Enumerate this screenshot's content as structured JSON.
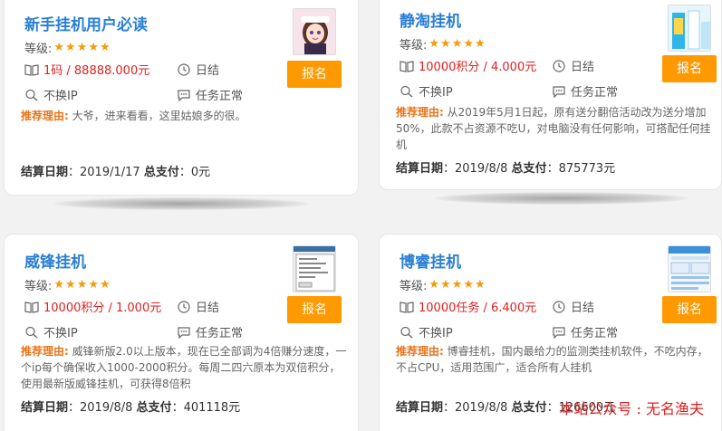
{
  "cards": [
    {
      "title": "新手挂机用户必读",
      "level_label": "等级:",
      "stars": "★★★★★",
      "price": "1码 / 88888.000元",
      "cycle": "日结",
      "ip": "不换IP",
      "status": "任务正常",
      "button": "报名",
      "reason_label": "推荐理由:",
      "reason": "大爷，进来看看，这里姑娘多的很。",
      "settle_label": "结算日期",
      "settle_date": "：2019/1/17",
      "pay_label": "总支付",
      "pay_value": "：0元"
    },
    {
      "title": "静淘挂机",
      "level_label": "等级:",
      "stars": "★★★★★",
      "price": "10000积分 / 4.000元",
      "cycle": "日结",
      "ip": "不换IP",
      "status": "任务正常",
      "button": "报名",
      "reason_label": "推荐理由:",
      "reason": "从2019年5月1日起，原有送分翻倍活动改为送分增加50%，此款不占资源不吃U，对电脑没有任何影响，可搭配任何挂机",
      "settle_label": "结算日期",
      "settle_date": "：2019/8/8",
      "pay_label": "总支付",
      "pay_value": "：875773元"
    },
    {
      "title": "威锋挂机",
      "level_label": "等级:",
      "stars": "★★★★★",
      "price": "10000积分 / 1.000元",
      "cycle": "日结",
      "ip": "不换IP",
      "status": "任务正常",
      "button": "报名",
      "reason_label": "推荐理由:",
      "reason": "威锋新版2.0以上版本，现在已全部调为4倍赚分速度，一个ip每个确保收入1000-2000积分。每周二四六原本为双倍积分，使用最新版威锋挂机，可获得8倍积",
      "settle_label": "结算日期",
      "settle_date": "：2019/8/8",
      "pay_label": "总支付",
      "pay_value": "：401118元"
    },
    {
      "title": "博睿挂机",
      "level_label": "等级:",
      "stars": "★★★★★",
      "price": "10000任务 / 6.400元",
      "cycle": "日结",
      "ip": "不换IP",
      "status": "任务正常",
      "button": "报名",
      "reason_label": "推荐理由:",
      "reason": "博睿挂机，国内最给力的监测类挂机软件，不吃内存，不占CPU，适用范围广，适合所有人挂机",
      "settle_label": "结算日期",
      "settle_date": "：2019/8/8",
      "pay_label": "总支付",
      "pay_value": "：126600元"
    }
  ],
  "watermark": "本站公众号 : 无名渔夫",
  "colors": {
    "title": "#2a7fd4",
    "button": "#ff9900",
    "star": "#f59a0c",
    "price": "#e02020",
    "reason_label": "#e8741a"
  }
}
